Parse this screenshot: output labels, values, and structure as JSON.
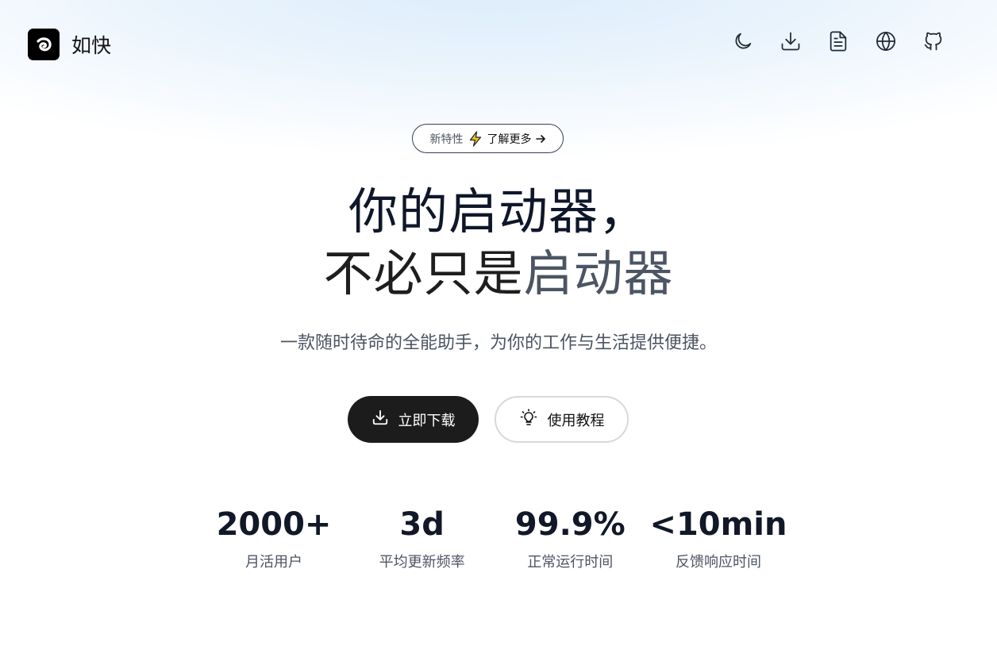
{
  "header": {
    "brand_name": "如快",
    "icons": [
      "moon-icon",
      "download-icon",
      "document-icon",
      "globe-icon",
      "github-icon"
    ]
  },
  "announcement": {
    "label": "新特性",
    "icon": "lightning-icon",
    "link_text": "了解更多",
    "arrow": "→"
  },
  "hero": {
    "line1": "你的启动器，",
    "line2_dark": "不必只是",
    "line2_accent": "启动器",
    "subtitle": "一款随时待命的全能助手，为你的工作与生活提供便捷。"
  },
  "buttons": {
    "download": "立即下载",
    "tutorial": "使用教程"
  },
  "stats": [
    {
      "value": "2000+",
      "label": "月活用户"
    },
    {
      "value": "3d",
      "label": "平均更新频率"
    },
    {
      "value": "99.9%",
      "label": "正常运行时间"
    },
    {
      "value": "<10min",
      "label": "反馈响应时间"
    }
  ],
  "colors": {
    "primary_button": "#1c1c1c",
    "accent_text": "#4b5563",
    "lightning": "#f5c518"
  }
}
